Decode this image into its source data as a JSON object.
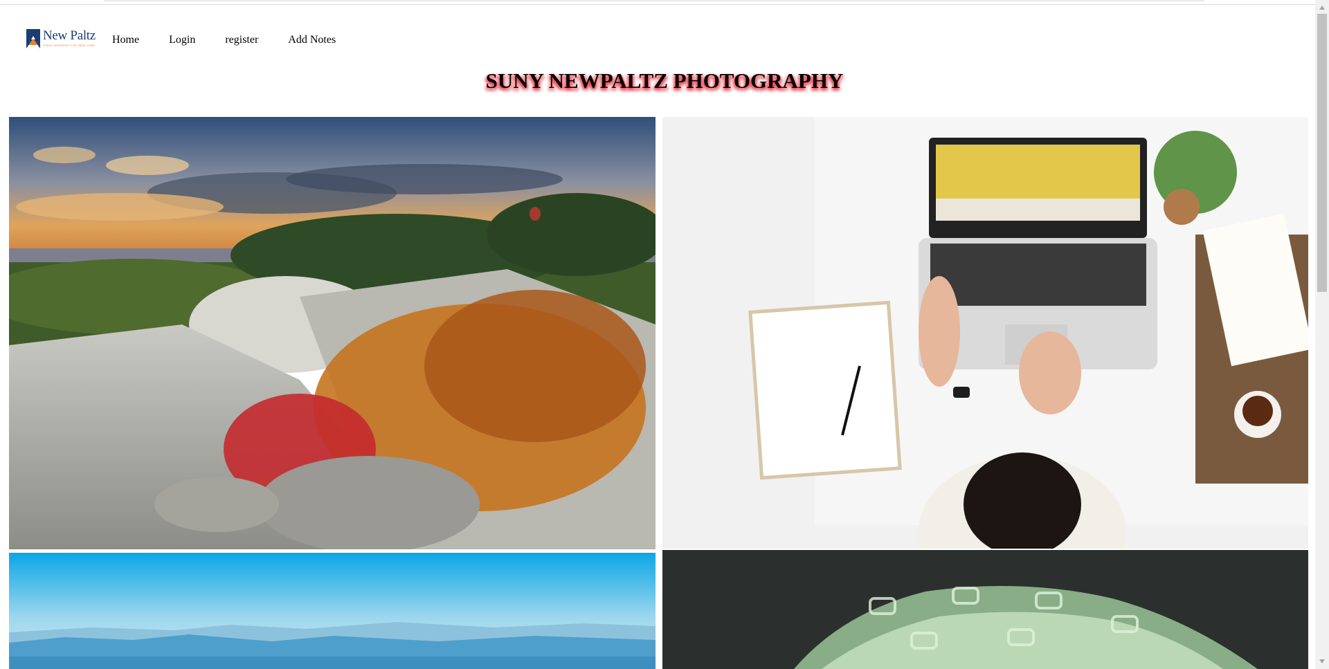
{
  "nav": {
    "logo": {
      "wordmark": "New Paltz",
      "tagline": "STATE UNIVERSITY OF NEW YORK",
      "colors": {
        "primary": "#1a3e72",
        "accent": "#f47b20"
      }
    },
    "links": [
      {
        "label": "Home"
      },
      {
        "label": "Login"
      },
      {
        "label": "register"
      },
      {
        "label": "Add Notes"
      }
    ]
  },
  "page": {
    "title": "SUNY NEWPALTZ PHOTOGRAPHY",
    "title_shadow_color": "#e8333f"
  },
  "gallery": {
    "photos": [
      {
        "subject": "autumn rocky ridge at sunset"
      },
      {
        "subject": "person typing on laptop at white desk"
      },
      {
        "subject": "blue sky over distant mountain range"
      },
      {
        "subject": "green translucent chain links on dark background"
      }
    ]
  }
}
